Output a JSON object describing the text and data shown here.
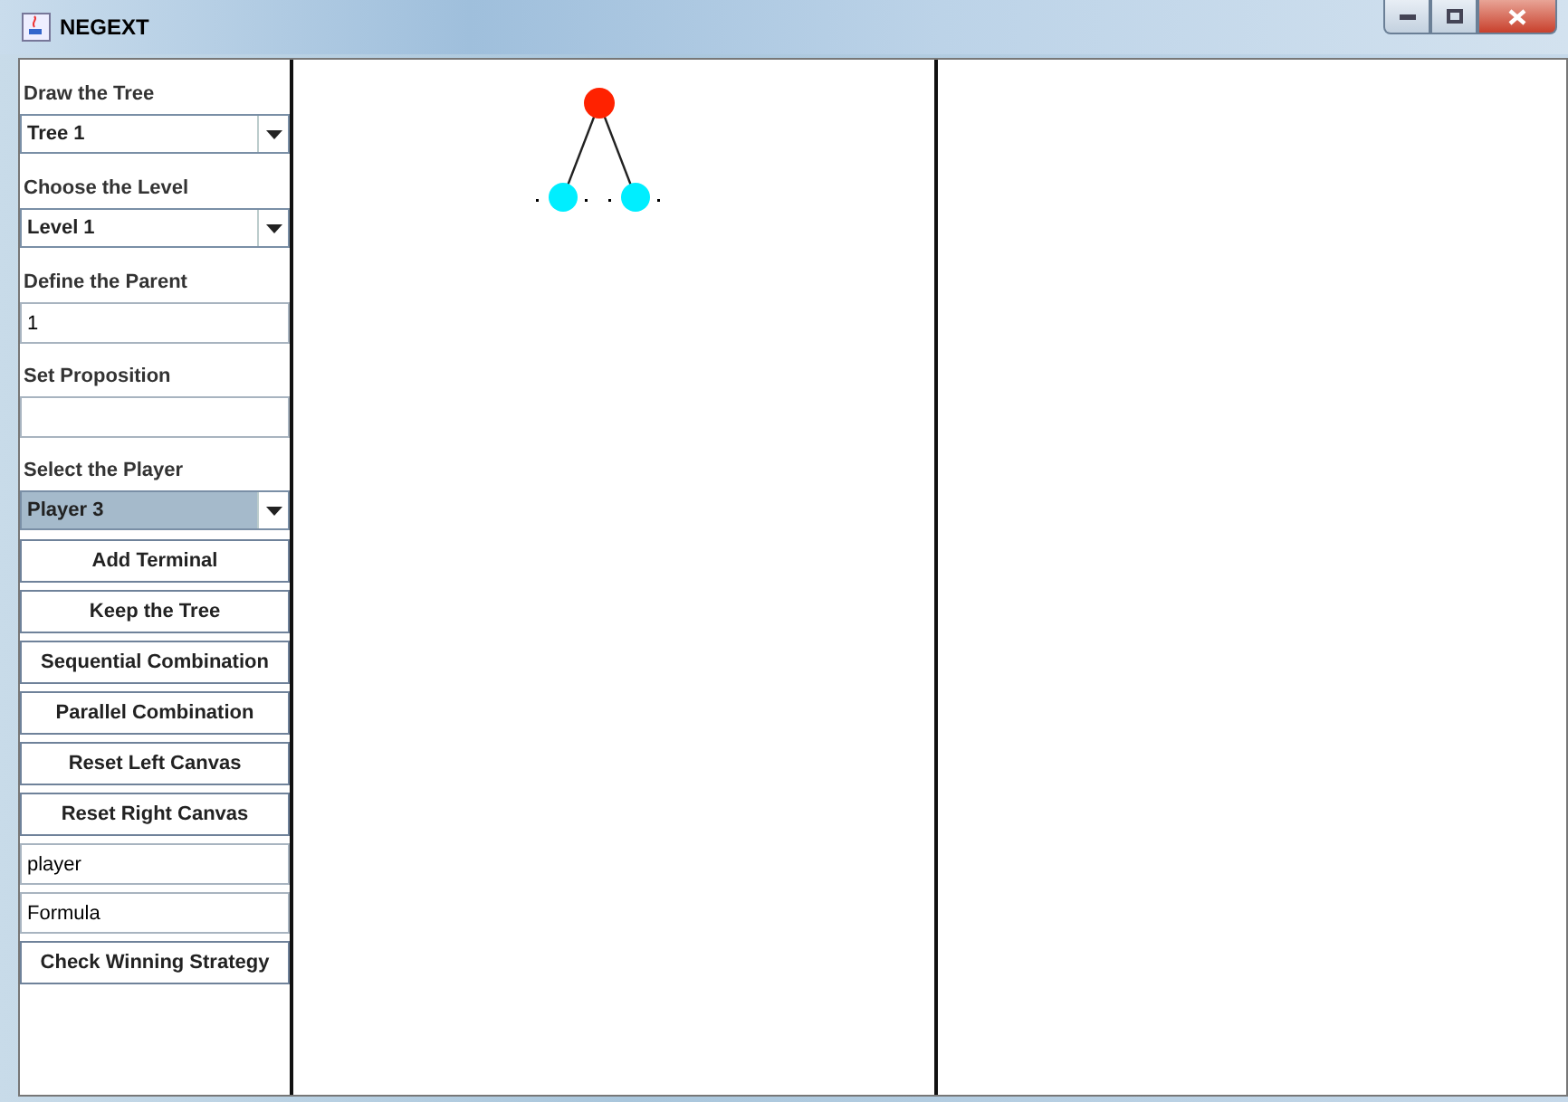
{
  "window": {
    "title": "NEGEXT"
  },
  "controls": [
    {
      "kind": "label",
      "text": "Draw the Tree"
    },
    {
      "kind": "dropdown",
      "value": "Tree 1",
      "highlighted": false
    },
    {
      "kind": "label",
      "text": "Choose the Level"
    },
    {
      "kind": "dropdown",
      "value": "Level 1",
      "highlighted": false
    },
    {
      "kind": "label",
      "text": "Define the Parent"
    },
    {
      "kind": "field",
      "value": "1"
    },
    {
      "kind": "label",
      "text": "Set Proposition"
    },
    {
      "kind": "field"
    },
    {
      "kind": "label",
      "text": "Select the Player"
    },
    {
      "kind": "dropdown",
      "value": "Player 3",
      "highlighted": true
    },
    {
      "kind": "button",
      "text": "Add Terminal"
    },
    {
      "kind": "button",
      "text": "Keep the Tree"
    },
    {
      "kind": "button",
      "text": "Sequential Combination"
    },
    {
      "kind": "button",
      "text": "Parallel Combination"
    },
    {
      "kind": "button",
      "text": "Reset Left Canvas"
    },
    {
      "kind": "button",
      "text": "Reset Right Canvas"
    },
    {
      "kind": "field",
      "value": "player"
    },
    {
      "kind": "field",
      "value": "Formula"
    },
    {
      "kind": "button",
      "text": "Check Winning Strategy"
    }
  ],
  "left_canvas": {
    "tree": {
      "color": "#ff2200",
      "children": [
        {
          "color": "#00eeff"
        },
        {
          "color": "#00eeff"
        }
      ]
    }
  }
}
